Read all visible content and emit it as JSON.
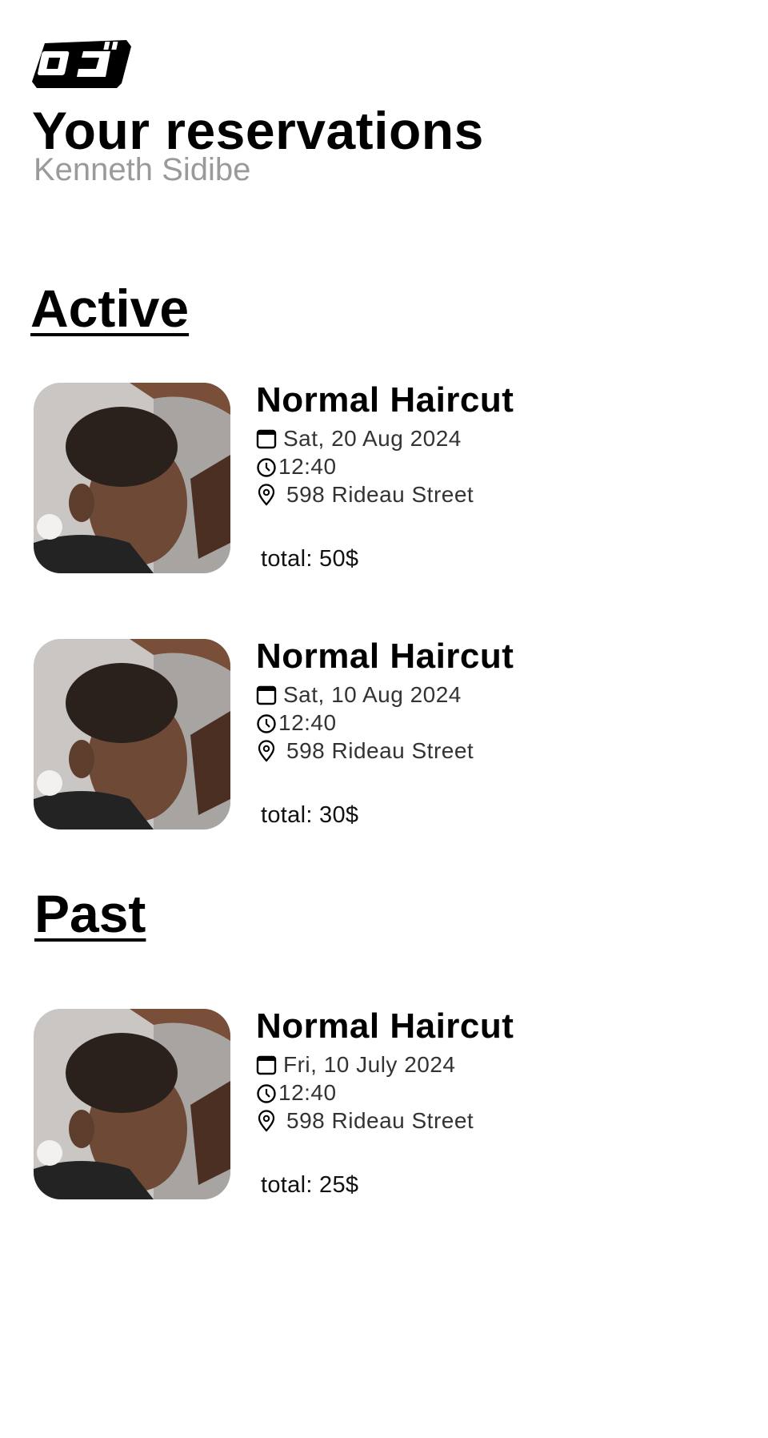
{
  "header": {
    "logo": "barber-logo",
    "title": "Your reservations",
    "user_name": "Kenneth Sidibe"
  },
  "sections": {
    "active": {
      "title": "Active",
      "reservations": [
        {
          "service": "Normal Haircut",
          "date": "Sat, 20 Aug 2024",
          "time": "12:40",
          "address": "598 Rideau Street",
          "total": "total: 50$"
        },
        {
          "service": "Normal Haircut",
          "date": "Sat, 10 Aug 2024",
          "time": "12:40",
          "address": "598 Rideau Street",
          "total": "total: 30$"
        }
      ]
    },
    "past": {
      "title": "Past",
      "reservations": [
        {
          "service": "Normal Haircut",
          "date": "Fri, 10 July 2024",
          "time": "12:40",
          "address": "598 Rideau Street",
          "total": "total: 25$"
        }
      ]
    }
  },
  "icons": {
    "date": "calendar-icon",
    "time": "clock-icon",
    "address": "location-pin-icon",
    "thumbnail": "haircut-photo"
  }
}
